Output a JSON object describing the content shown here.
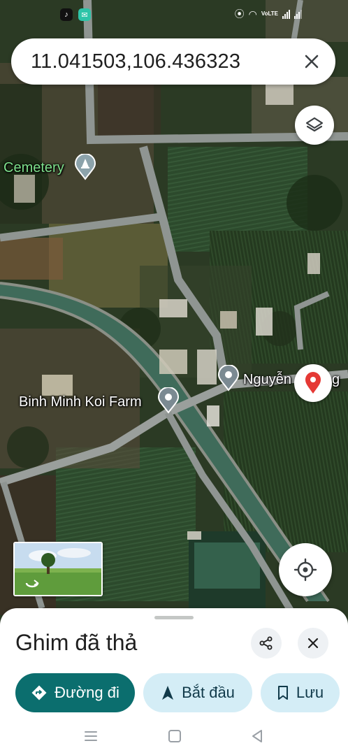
{
  "status_bar": {
    "apps": [
      "tiktok-icon",
      "messenger-icon"
    ],
    "network_label": "VoLTE",
    "icons": [
      "location-icon",
      "wifi-icon",
      "signal-icon",
      "signal-icon"
    ]
  },
  "search": {
    "query": "11.041503,106.436323",
    "clear_icon": "close-icon"
  },
  "map": {
    "labels": {
      "cemetery": "Cemetery",
      "koi_farm": "Binh Minh Koi Farm",
      "street_partial": "Nguyễn",
      "street_tail": "g"
    },
    "colors": {
      "pin": "#e53935",
      "poi_gray": "#7b8a92",
      "field": "#2f4a2a"
    }
  },
  "sheet": {
    "title": "Ghim đã thả",
    "share_icon": "share-icon",
    "close_icon": "close-icon",
    "actions": {
      "directions": "Đường đi",
      "start": "Bắt đầu",
      "save": "Lưu"
    },
    "colors": {
      "primary": "#0b6e6e",
      "secondary": "#d4edf6"
    }
  },
  "nav_bar": [
    "menu-icon",
    "home-icon",
    "back-icon"
  ]
}
